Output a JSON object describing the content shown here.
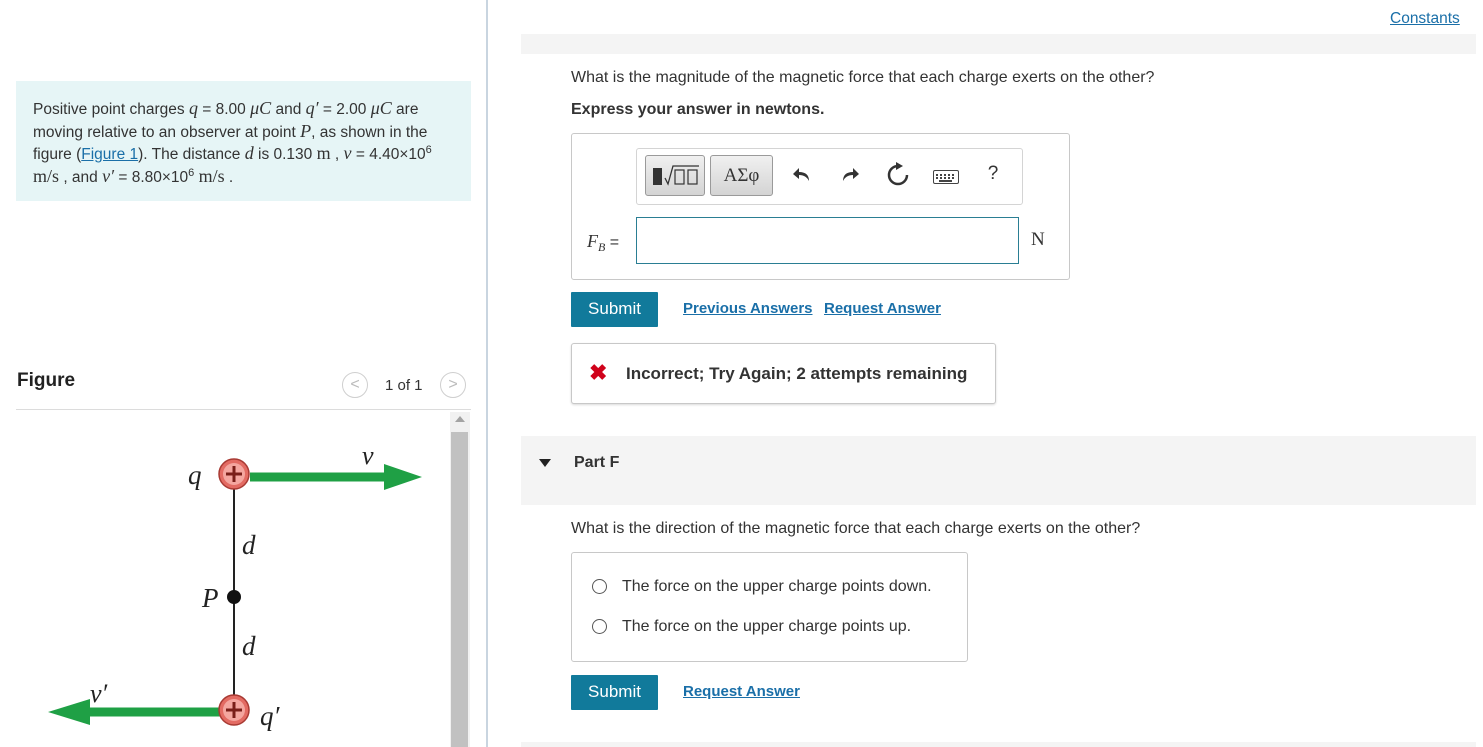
{
  "problem": {
    "t1": "Positive point charges ",
    "q_sym": "q",
    "t2": " = 8.00 ",
    "uC": "μC",
    "t3": " and ",
    "qp_sym": "q′",
    "t4": " = 2.00 ",
    "t5": " are moving relative to an observer at point ",
    "P_sym": "P",
    "t6": ", as shown in the figure (",
    "figure_link": "Figure 1",
    "t7": "). The distance ",
    "d_sym": "d",
    "t8": " is 0.130 ",
    "m_unit": "m",
    "t9": " , ",
    "v_sym": "v",
    "t10": " = 4.40×10",
    "exp6": "6",
    "ms_unit": "m/s",
    "t11": " , and ",
    "vp_sym": "v′",
    "t12": " = 8.80×10",
    "t13": " ."
  },
  "figure": {
    "title": "Figure",
    "prev": "<",
    "next": ">",
    "count": "1 of 1",
    "label_q": "q",
    "label_v": "v",
    "label_d1": "d",
    "label_P": "P",
    "label_d2": "d",
    "label_vp": "v′",
    "label_qp": "q′",
    "arrow_color": "#1fa045",
    "charge_color": "#e36b63"
  },
  "header": {
    "constants": "Constants"
  },
  "part_e": {
    "question": "What is the magnitude of the magnetic force that each charge exerts on the other?",
    "instruction": "Express your answer in newtons.",
    "toolbar": {
      "greek": "ΑΣφ",
      "undo_icon": "undo-icon",
      "redo_icon": "redo-icon",
      "reset_icon": "reset-icon",
      "keyboard_icon": "keyboard-icon",
      "help": "?"
    },
    "input_label": "F",
    "input_label_sub": "B",
    "input_label_eq": " =",
    "input_value": "",
    "unit": "N",
    "submit": "Submit",
    "previous_answers": "Previous Answers",
    "request_answer": "Request Answer",
    "feedback_icon": "✖",
    "feedback": "Incorrect; Try Again; 2 attempts remaining"
  },
  "part_f": {
    "title": "Part F",
    "question": "What is the direction of the magnetic force that each charge exerts on the other?",
    "options": [
      "The force on the upper charge points down.",
      "The force on the upper charge points up."
    ],
    "submit": "Submit",
    "request_answer": "Request Answer"
  },
  "colors": {
    "accent": "#117a9b",
    "link": "#1a6fa8",
    "error": "#d0021b",
    "problem_bg": "#e6f5f6"
  }
}
